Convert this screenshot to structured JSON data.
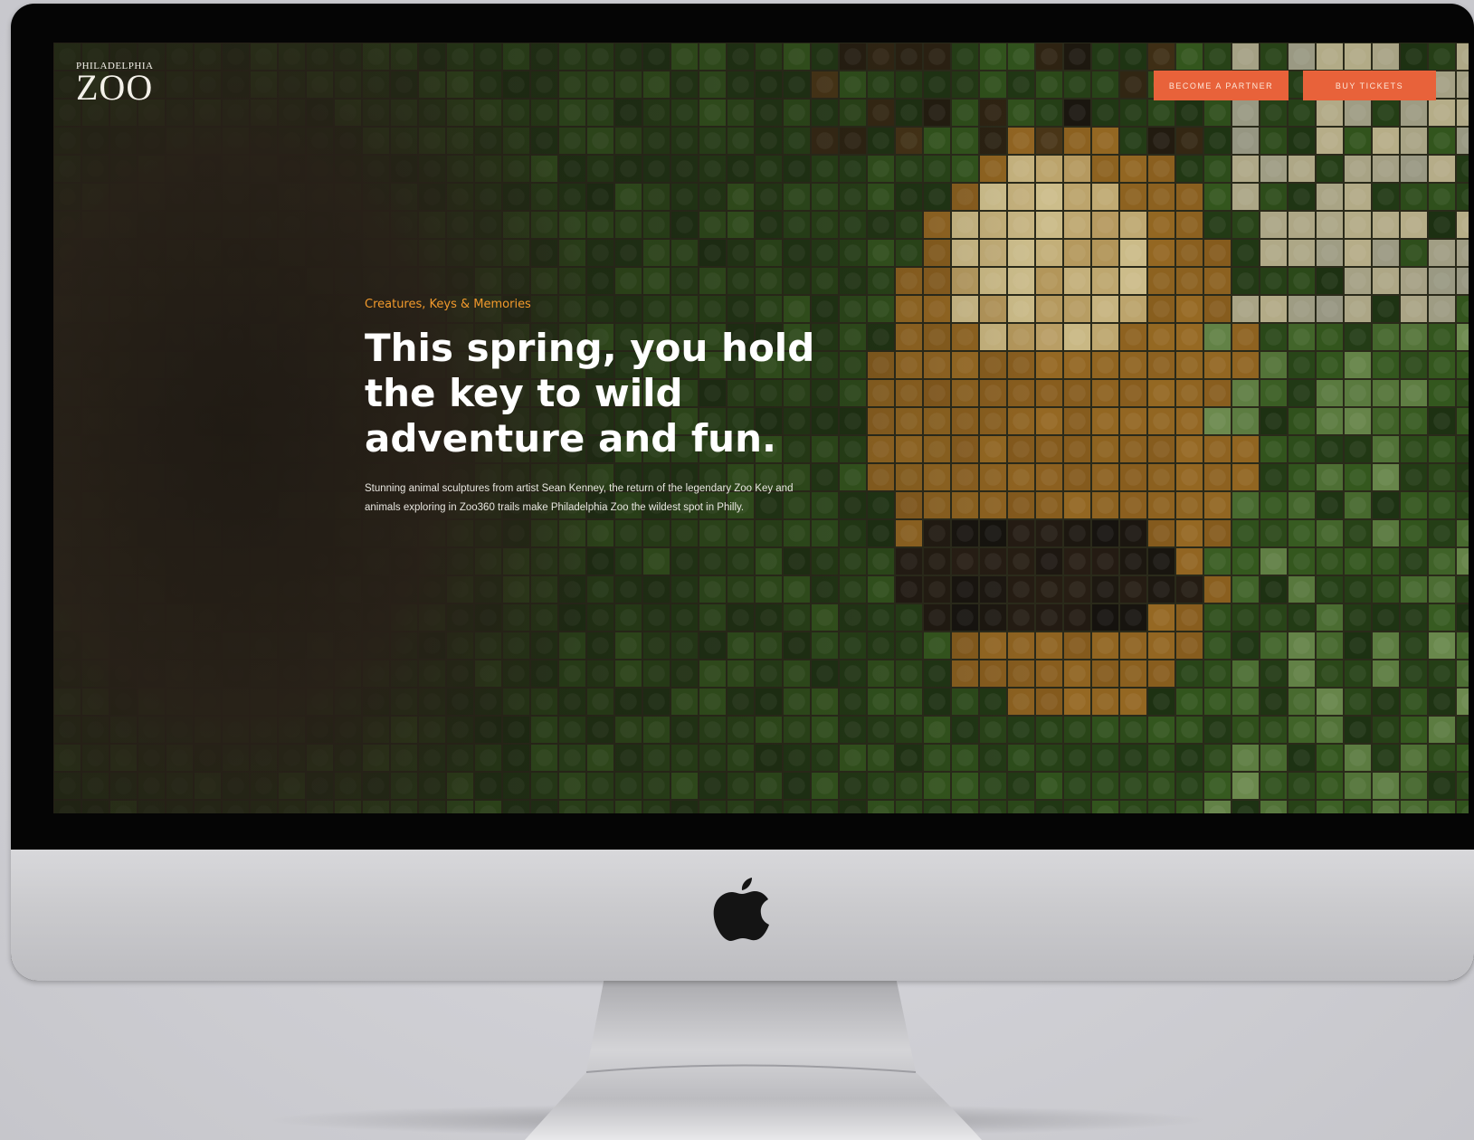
{
  "site": {
    "logo_small": "Philadelphia",
    "logo_main": "ZOO"
  },
  "header": {
    "partner_button": "Become a Partner",
    "tickets_button": "Buy Tickets"
  },
  "hero": {
    "eyebrow": "Creatures, Keys & Memories",
    "headline": "This spring, you hold the key to wild adventure and fun.",
    "body": "Stunning animal sculptures from artist Sean Kenney, the return of the legendary Zoo Key and animals exploring in Zoo360 trails make Philadelphia Zoo the wildest spot in Philly."
  },
  "colors": {
    "accent_button": "#e8623a",
    "eyebrow": "#f29a2c"
  }
}
